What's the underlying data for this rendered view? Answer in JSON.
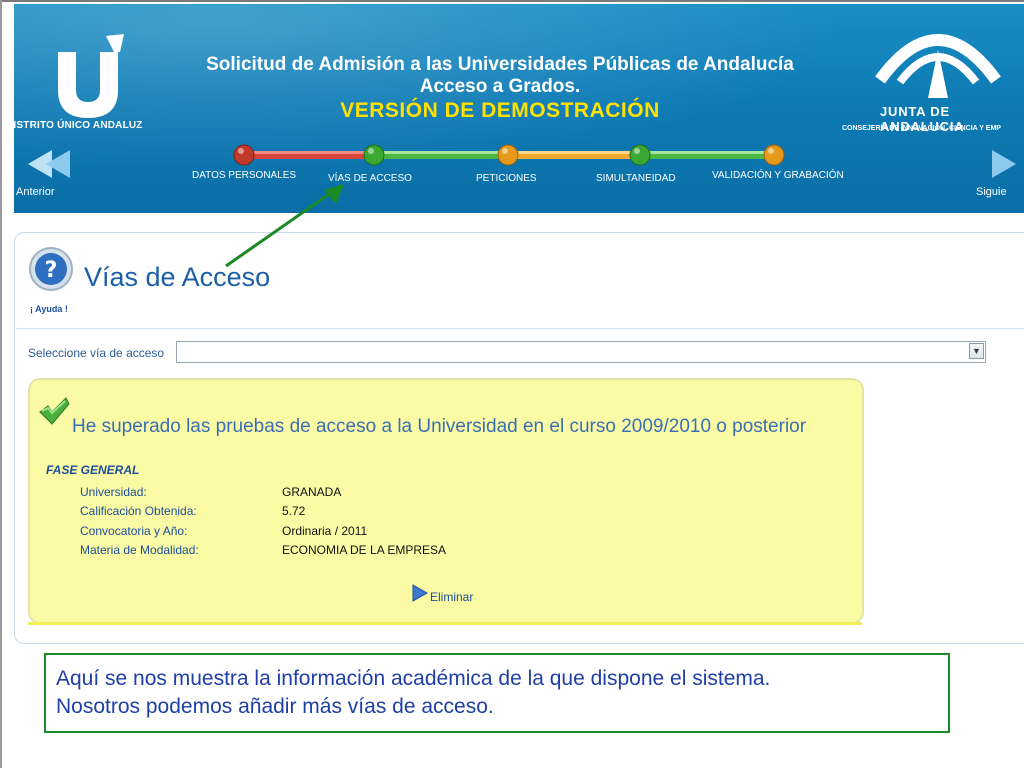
{
  "header": {
    "logo_caption": "DISTRITO ÚNICO ANDALUZ",
    "title_line1": "Solicitud de Admisión a las Universidades Públicas de Andalucía",
    "title_line2": "Acceso a Grados.",
    "title_line3": "VERSIÓN DE DEMOSTRACIÓN",
    "junta_name": "JUNTA DE ANDALUCIA",
    "junta_sub": "CONSEJERÍA DE INNOVACIÓN, CIENCIA Y EMP",
    "nav_prev": "Anterior",
    "nav_next": "Siguie",
    "steps": [
      {
        "label": "DATOS PERSONALES",
        "dot_color": "#c0392b"
      },
      {
        "label": "VÍAS DE ACCESO",
        "dot_color": "#3aa832"
      },
      {
        "label": "PETICIONES",
        "dot_color": "#e59a1b"
      },
      {
        "label": "SIMULTANEIDAD",
        "dot_color": "#3aa832"
      },
      {
        "label": "VALIDACIÓN Y GRABACIÓN",
        "dot_color": "#e59a1b"
      }
    ]
  },
  "page": {
    "help_label": "¡ Ayuda !",
    "title": "Vías de Acceso",
    "select_label": "Seleccione vía de acceso",
    "select_value": ""
  },
  "card": {
    "title": "He superado las pruebas de acceso a la Universidad en el curso 2009/2010 o posterior",
    "section": "FASE GENERAL",
    "rows": [
      {
        "label": "Universidad:",
        "value": "GRANADA"
      },
      {
        "label": "Calificación Obtenida:",
        "value": "5.72"
      },
      {
        "label": "Convocatoria y Año:",
        "value": "Ordinaria / 2011"
      },
      {
        "label": "Materia de Modalidad:",
        "value": "ECONOMIA DE LA EMPRESA"
      }
    ],
    "delete_label": "Eliminar"
  },
  "note": {
    "line1": "Aquí se nos muestra la información académica de la que dispone el sistema.",
    "line2": "Nosotros podemos añadir más vías de acceso."
  }
}
